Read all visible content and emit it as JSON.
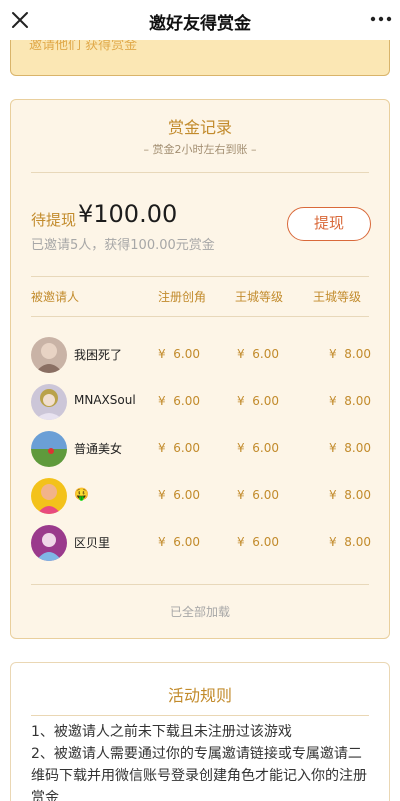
{
  "header": {
    "title": "邀好友得赏金",
    "close_icon": "close-icon",
    "more_icon": "more-icon"
  },
  "banner": {
    "text": "邀请他们 获得赏金"
  },
  "record": {
    "title": "赏金记录",
    "subtitle": "– 赏金2小时左右到账 –",
    "pending_label": "待提现",
    "amount": "¥100.00",
    "invited_text": "已邀请5人，获得100.00元赏金",
    "withdraw_button": "提现",
    "columns": [
      "被邀请人",
      "注册创角",
      "王城等级",
      "王城等级"
    ],
    "rows": [
      {
        "name": "我困死了",
        "v1": "¥  6.00",
        "v2": "¥  6.00",
        "v3": "¥  8.00",
        "avatar": "avatar-photo"
      },
      {
        "name": "MNAXSoul",
        "v1": "¥  6.00",
        "v2": "¥  6.00",
        "v3": "¥  8.00",
        "avatar": "avatar-photo"
      },
      {
        "name": "普通美女",
        "v1": "¥  6.00",
        "v2": "¥  6.00",
        "v3": "¥  8.00",
        "avatar": "avatar-photo"
      },
      {
        "name": "🤑",
        "v1": "¥  6.00",
        "v2": "¥  6.00",
        "v3": "¥  8.00",
        "avatar": "avatar-photo"
      },
      {
        "name": "区贝里",
        "v1": "¥  6.00",
        "v2": "¥  6.00",
        "v3": "¥  8.00",
        "avatar": "avatar-photo"
      }
    ],
    "loaded_text": "已全部加载"
  },
  "rules": {
    "title": "活动规则",
    "lines": [
      "1、被邀请人之前未下载且未注册过该游戏",
      "2、被邀请人需要通过你的专属邀请链接或专属邀请二维码下载并用微信账号登录创建角色才能记入你的注册赏金"
    ]
  },
  "colors": {
    "accent": "#c28b2c",
    "button": "#d9693a",
    "card_bg": "#fdf5e7",
    "banner_bg": "#fbe7b4"
  }
}
